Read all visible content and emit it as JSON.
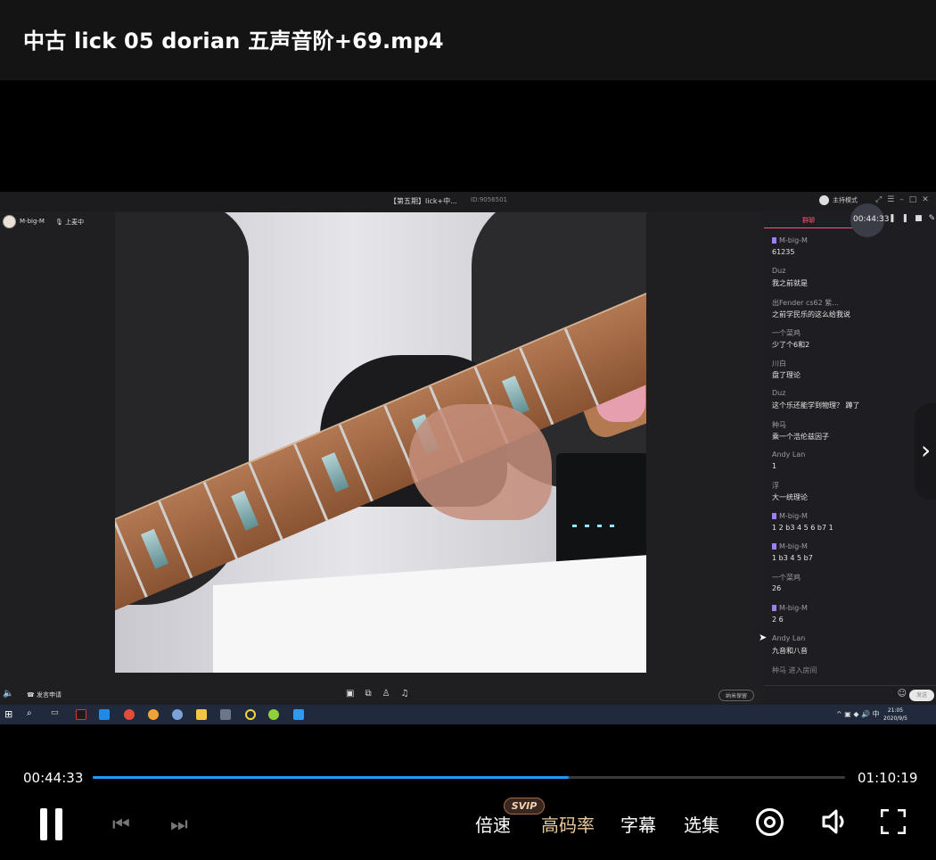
{
  "title": "中古 lick 05  dorian  五声音阶+69.mp4",
  "video": {
    "meeting_title": "【第五期】lick+中...",
    "meeting_id": "ID:9056501",
    "host_mode": "主持模式",
    "user_name": "M-big-M",
    "on_mic": "上麦中",
    "chat_tab": "群聊",
    "overlay_time": "00:44:33",
    "messages": [
      {
        "name": "M-big-M",
        "badge": true,
        "text": "61235"
      },
      {
        "name": "Duz",
        "badge": false,
        "text": "我之前就是"
      },
      {
        "name": "出Fender cs62 紫...",
        "badge": false,
        "text": "之前学民乐的这么给我说"
      },
      {
        "name": "一个菜鸡",
        "badge": false,
        "text": "少了个6和2"
      },
      {
        "name": "川白",
        "badge": false,
        "text": "盘了理论"
      },
      {
        "name": "Duz",
        "badge": false,
        "text": "这个乐还能学到物理？ 蹲了"
      },
      {
        "name": "种马",
        "badge": false,
        "text": "乘一个浩伦兹因子"
      },
      {
        "name": "Andy Lan",
        "badge": false,
        "text": "1"
      },
      {
        "name": "浮",
        "badge": false,
        "text": "大一统理论"
      },
      {
        "name": "M-big-M",
        "badge": true,
        "text": "1 2 b3 4 5 6 b7 1"
      },
      {
        "name": "M-big-M",
        "badge": true,
        "text": "1 b3 4 5 b7"
      },
      {
        "name": "一个菜鸡",
        "badge": false,
        "text": "26"
      },
      {
        "name": "M-big-M",
        "badge": true,
        "text": "2     6"
      },
      {
        "name": "Andy Lan",
        "badge": false,
        "text": "九音和八音"
      }
    ],
    "system_message": "种马 进入房间",
    "send_label": "发送",
    "apply_label": "发言申请",
    "save_label": "纳米保留",
    "clock_time": "21:05",
    "clock_date": "2020/9/5",
    "ime_label": "中"
  },
  "player": {
    "current_time": "00:44:33",
    "total_time": "01:10:19",
    "progress": 0.633,
    "speed_label": "倍速",
    "hq_label": "高码率",
    "svip_badge": "SVIP",
    "subtitle_label": "字幕",
    "episodes_label": "选集"
  },
  "icons": {
    "pause": "pause-icon",
    "prev": "skip-previous-icon",
    "next": "skip-next-icon",
    "target": "target-icon",
    "volume": "volume-icon",
    "fullscreen": "fullscreen-icon"
  },
  "colors": {
    "accent": "#1e9bff",
    "hq": "#e9c89a",
    "chat_tab": "#ff5675"
  }
}
